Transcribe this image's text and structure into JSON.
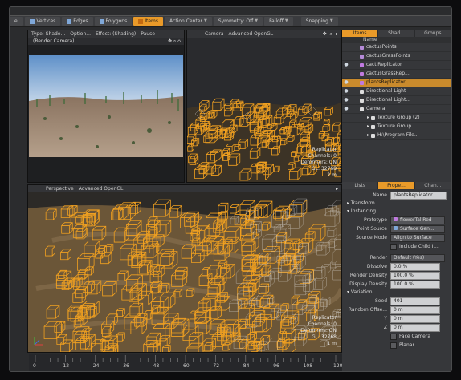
{
  "toolbar": {
    "items": [
      {
        "label": "el",
        "active": false
      },
      {
        "label": "Vertices",
        "active": false
      },
      {
        "label": "Edges",
        "active": false
      },
      {
        "label": "Polygons",
        "active": false
      },
      {
        "label": "Items",
        "active": true
      },
      {
        "label": "Action Center",
        "active": false
      },
      {
        "label": "Symmetry: Off",
        "active": false
      },
      {
        "label": "Falloff",
        "active": false
      },
      {
        "label": "Snapping",
        "active": false
      }
    ]
  },
  "vp_topleft": {
    "bar": [
      "Type: Shade...",
      "Option...",
      "Effect: (Shading)",
      "Pause"
    ],
    "sub": "(Render Camera)"
  },
  "vp_topright": {
    "bar": [
      "Camera",
      "Advanced OpenGL"
    ],
    "hud": [
      "Replicator",
      "Channels: 0",
      "Deformers: ON",
      "GL: 32768",
      "2 m"
    ]
  },
  "vp_bottom": {
    "bar": [
      "Perspective",
      "Advanced OpenGL"
    ],
    "hud": [
      "Replicator",
      "Channels: 0",
      "Deformers: ON",
      "GL: 32768",
      "1 m"
    ]
  },
  "panel": {
    "top_tabs": [
      "Items",
      "Shad...",
      "Groups"
    ],
    "list_header": "Name",
    "items": [
      {
        "label": "cactusPoints",
        "eye": false,
        "color": "#b58ad8",
        "selected": false,
        "indent": 2
      },
      {
        "label": "cactusGrassPoints",
        "eye": false,
        "color": "#b58ad8",
        "selected": false,
        "indent": 2
      },
      {
        "label": "cactiReplicator",
        "eye": true,
        "color": "#c07ae0",
        "selected": false,
        "indent": 2
      },
      {
        "label": "cactusGrassRep...",
        "eye": false,
        "color": "#c07ae0",
        "selected": false,
        "indent": 2
      },
      {
        "label": "plantsReplicator",
        "eye": true,
        "color": "#c07ae0",
        "selected": true,
        "indent": 2
      },
      {
        "label": "Directional Light",
        "eye": true,
        "color": "#dddddd",
        "selected": false,
        "indent": 2
      },
      {
        "label": "Directional Light...",
        "eye": true,
        "color": "#dddddd",
        "selected": false,
        "indent": 2
      },
      {
        "label": "Camera",
        "eye": true,
        "color": "#dddddd",
        "selected": false,
        "indent": 2
      },
      {
        "label": "Texture Group (2)",
        "eye": false,
        "color": "#dddddd",
        "selected": false,
        "indent": 4
      },
      {
        "label": "Texture Group",
        "eye": false,
        "color": "#dddddd",
        "selected": false,
        "indent": 4
      },
      {
        "label": "H:\\Program File...",
        "eye": false,
        "color": "#dddddd",
        "selected": false,
        "indent": 4
      }
    ],
    "prop_tabs": [
      "Lists",
      "Prope...",
      "Chan..."
    ],
    "name_label": "Name",
    "name_value": "plantsReplicator",
    "sec_transform": "Transform",
    "sec_instancing": "Instancing",
    "prototype_label": "Prototype",
    "prototype_value": "flowerTallRed",
    "point_source_label": "Point Source",
    "point_source_value": "Surface Gen...",
    "source_mode_label": "Source Mode",
    "source_mode_value": "Align to Surface",
    "include_child": "Include Child It...",
    "render_label": "Render",
    "render_value": "Default (Yes)",
    "dissolve_label": "Dissolve",
    "dissolve_value": "0.0 %",
    "render_density_label": "Render Density",
    "render_density_value": "100.0 %",
    "display_density_label": "Display Density",
    "display_density_value": "100.0 %",
    "sec_variation": "Variation",
    "seed_label": "Seed",
    "seed_value": "401",
    "random_offset_label": "Random Offse...",
    "offset_x": "0 m",
    "offset_y_label": "Y",
    "offset_y": "0 m",
    "offset_z_label": "Z",
    "offset_z": "0 m",
    "face_camera": "Face Camera",
    "planar": "Planar"
  },
  "timeline": {
    "ticks": [
      "0",
      "12",
      "24",
      "36",
      "48",
      "60",
      "72",
      "84",
      "96",
      "108",
      "120"
    ]
  },
  "colors": {
    "accent": "#e99a29",
    "wire": "#f0a020"
  }
}
